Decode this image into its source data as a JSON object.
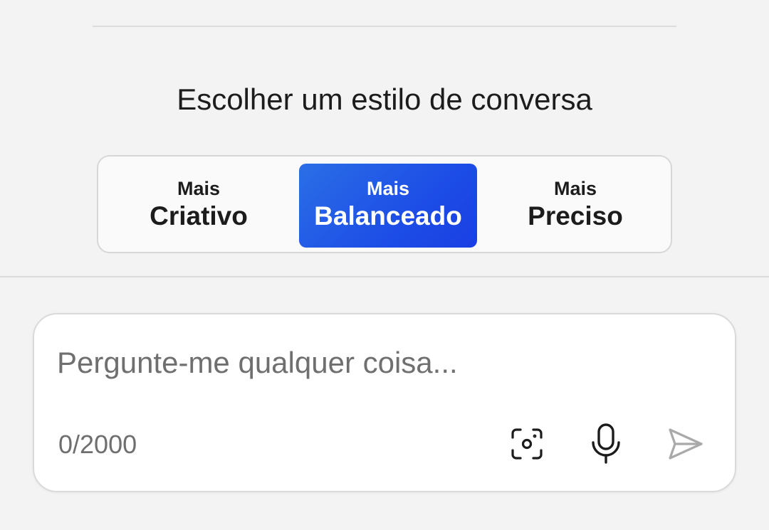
{
  "heading": "Escolher um estilo de conversa",
  "styles": [
    {
      "small": "Mais",
      "big": "Criativo",
      "selected": false
    },
    {
      "small": "Mais",
      "big": "Balanceado",
      "selected": true
    },
    {
      "small": "Mais",
      "big": "Preciso",
      "selected": false
    }
  ],
  "composer": {
    "placeholder": "Pergunte-me qualquer coisa...",
    "value": "",
    "char_count": "0/2000",
    "icons": [
      "visual-search-icon",
      "microphone-icon",
      "send-icon"
    ]
  },
  "colors": {
    "accent_start": "#2b6fe6",
    "accent_end": "#1a3fe3",
    "background": "#f3f3f3"
  }
}
